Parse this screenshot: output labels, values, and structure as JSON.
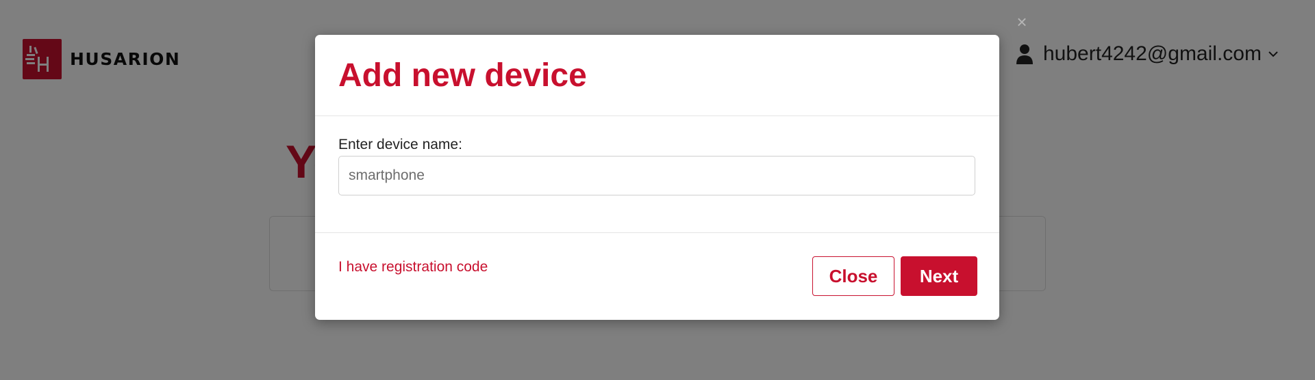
{
  "header": {
    "brand": "HUSARION",
    "user_email": "hubert4242@gmail.com"
  },
  "background": {
    "title_fragment": "Yo"
  },
  "modal": {
    "title": "Add new device",
    "field_label": "Enter device name:",
    "input_value": "",
    "input_placeholder": "smartphone",
    "registration_link": "I have registration code",
    "close_label": "Close",
    "next_label": "Next"
  },
  "colors": {
    "accent": "#c8102e",
    "overlay": "rgba(0,0,0,0.5)"
  },
  "icons": {
    "logo": "husarion-logo-icon",
    "user": "user-icon",
    "chevron": "chevron-down-icon",
    "dismiss": "close-icon"
  }
}
